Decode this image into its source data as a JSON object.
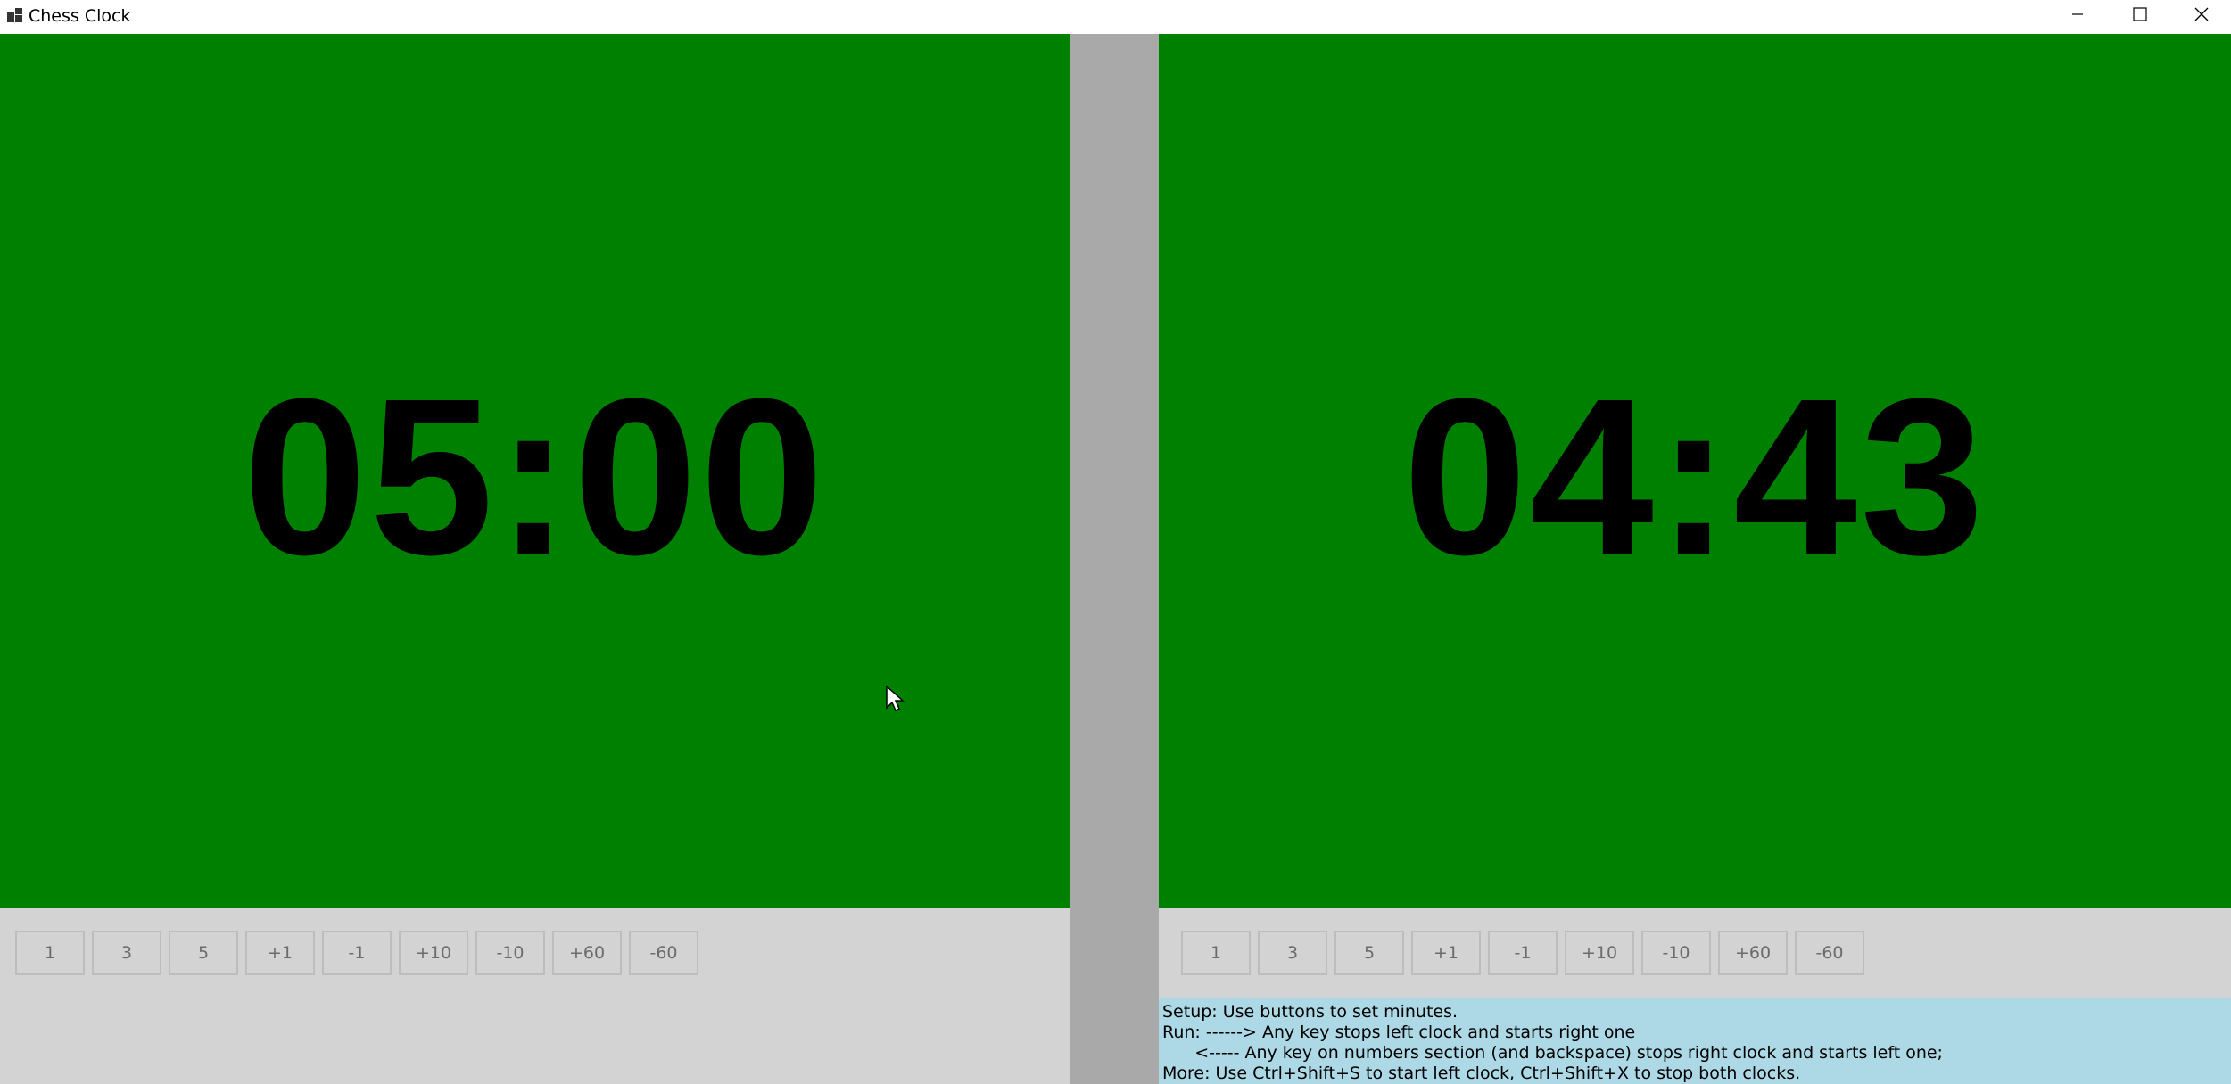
{
  "window": {
    "title": "Chess Clock"
  },
  "left_clock": {
    "time": "05:00",
    "buttons": [
      "1",
      "3",
      "5",
      "+1",
      "-1",
      "+10",
      "-10",
      "+60",
      "-60"
    ]
  },
  "right_clock": {
    "time": "04:43",
    "buttons": [
      "1",
      "3",
      "5",
      "+1",
      "-1",
      "+10",
      "-10",
      "+60",
      "-60"
    ]
  },
  "help": {
    "line1": "Setup: Use buttons to set minutes.",
    "line2": "Run: ------> Any key stops left clock and starts right one",
    "line3": "      <----- Any key on numbers section (and backspace) stops right clock and starts left one;",
    "line4": "More: Use Ctrl+Shift+S to start left clock, Ctrl+Shift+X to stop both clocks."
  },
  "colors": {
    "clock_active": "#008000",
    "controls_bg": "#d3d3d3",
    "divider": "#a9a9a9",
    "help_bg": "#add8e6"
  },
  "icons": {
    "app": "app-icon",
    "minimize": "minimize-icon",
    "maximize": "maximize-icon",
    "close": "close-icon",
    "cursor": "mouse-pointer-icon"
  }
}
